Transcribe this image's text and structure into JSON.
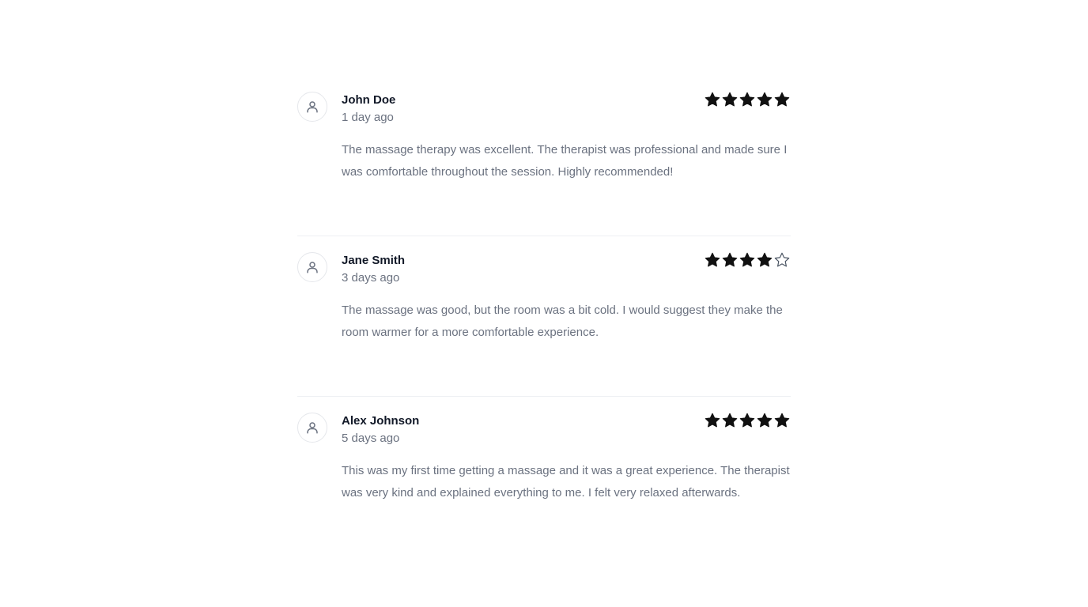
{
  "reviews": [
    {
      "name": "John Doe",
      "time": "1 day ago",
      "rating": 5,
      "max_rating": 5,
      "text": "The massage therapy was excellent. The therapist was professional and made sure I was comfortable throughout the session. Highly recommended!"
    },
    {
      "name": "Jane Smith",
      "time": "3 days ago",
      "rating": 4,
      "max_rating": 5,
      "text": "The massage was good, but the room was a bit cold. I would suggest they make the room warmer for a more comfortable experience."
    },
    {
      "name": "Alex Johnson",
      "time": "5 days ago",
      "rating": 5,
      "max_rating": 5,
      "text": "This was my first time getting a massage and it was a great experience. The therapist was very kind and explained everything to me. I felt very relaxed afterwards."
    }
  ],
  "icons": {
    "avatar": "user-icon",
    "star_filled": "star-filled-icon",
    "star_empty": "star-outline-icon"
  },
  "colors": {
    "name_text": "#111827",
    "muted_text": "#6b7280",
    "star": "#111111",
    "divider": "#eef0f3"
  }
}
